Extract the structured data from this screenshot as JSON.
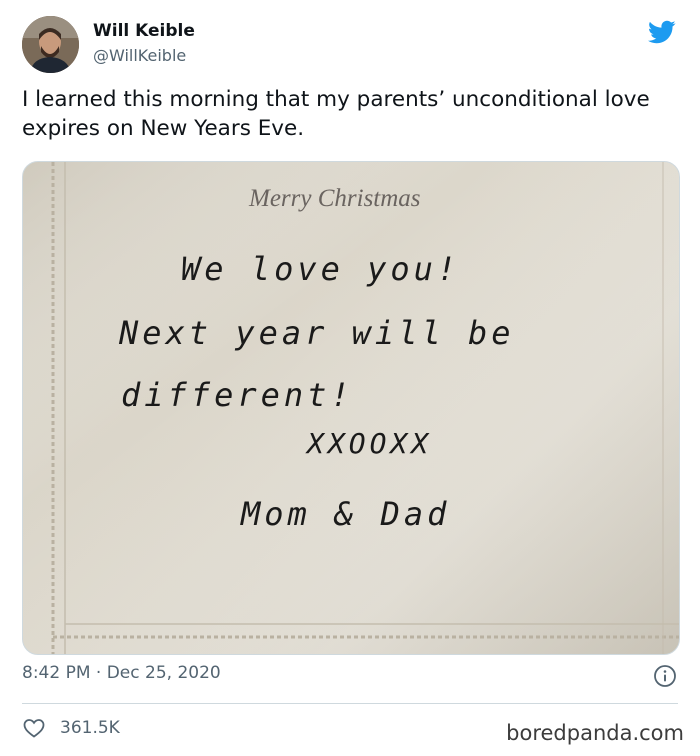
{
  "author": {
    "name": "Will Keible",
    "handle": "@WillKeible",
    "avatar_icon": "user-avatar-photo"
  },
  "brand": {
    "icon": "twitter-bird-icon",
    "color": "#1d9bf0"
  },
  "tweet": {
    "text": "I learned this morning that my parents’ unconditional love expires on New Years Eve."
  },
  "photo": {
    "printed_heading": "Merry Christmas",
    "handwritten_lines": [
      "We love you!",
      "Next year will be",
      "different!",
      "XXOOXX",
      "Mom & Dad"
    ]
  },
  "meta": {
    "timestamp": "8:42 PM · Dec 25, 2020",
    "info_icon": "info-icon"
  },
  "engagement": {
    "likes": "361.5K",
    "like_icon": "heart-icon"
  },
  "watermark": "boredpanda.com"
}
